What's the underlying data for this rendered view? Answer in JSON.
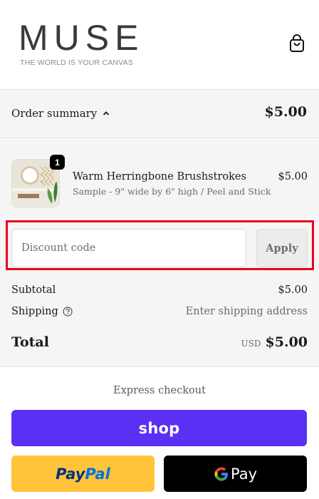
{
  "brand": {
    "name": "MUSE",
    "tagline": "THE WORLD IS YOUR CANVAS"
  },
  "header": {
    "cart_icon": "shopping-bag-icon"
  },
  "summary": {
    "toggle_label": "Order summary",
    "toggle_icon": "chevron-up-icon",
    "total": "$5.00"
  },
  "product": {
    "quantity": "1",
    "title": "Warm Herringbone Brushstrokes",
    "variant": "Sample - 9\" wide by 6\" high / Peel and Stick",
    "price": "$5.00"
  },
  "discount": {
    "placeholder": "Discount code",
    "apply_label": "Apply"
  },
  "totals": {
    "subtotal_label": "Subtotal",
    "subtotal_value": "$5.00",
    "shipping_label": "Shipping",
    "shipping_value": "Enter shipping address",
    "total_label": "Total",
    "currency": "USD",
    "total_value": "$5.00"
  },
  "express": {
    "label": "Express checkout",
    "shop_label": "shop",
    "paypal_pay": "Pay",
    "paypal_pal": "Pal",
    "gpay_g": "G",
    "gpay_label": "Pay"
  },
  "colors": {
    "shop_purple": "#5a31f4",
    "paypal_yellow": "#ffc439",
    "highlight_red": "#e8001c"
  }
}
